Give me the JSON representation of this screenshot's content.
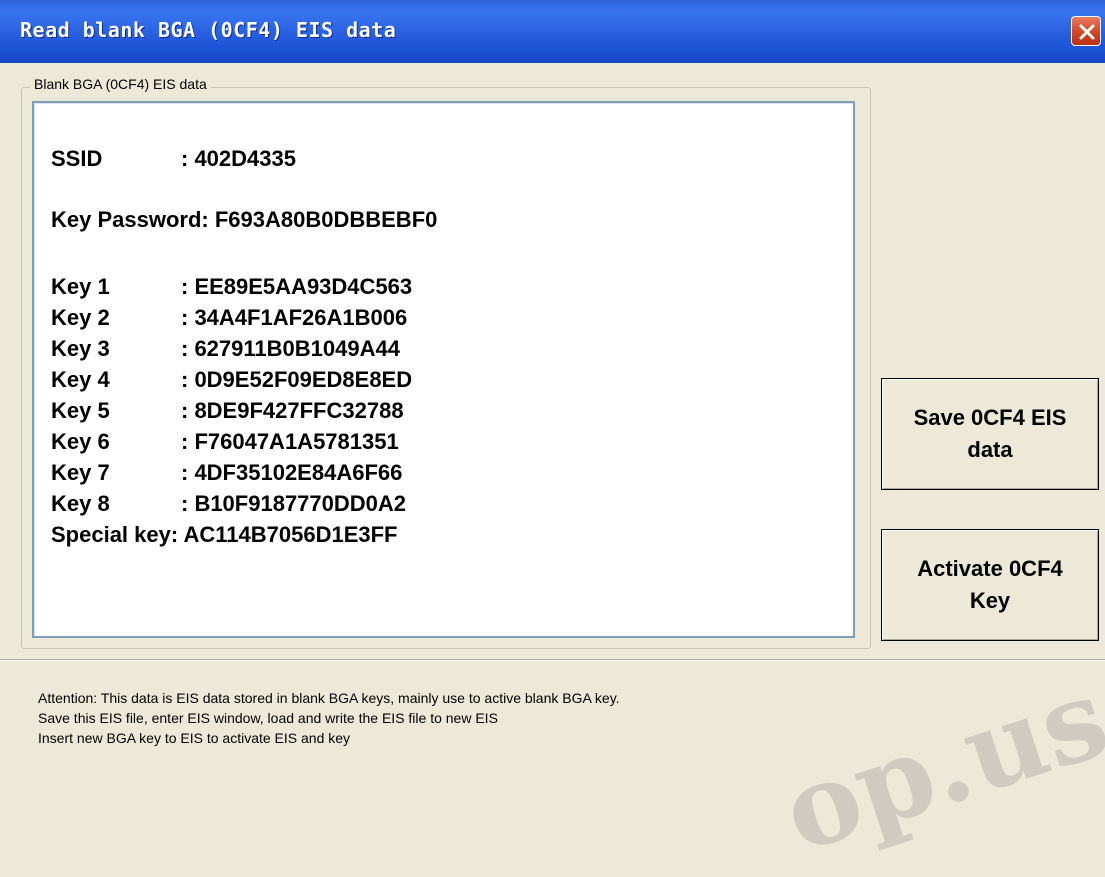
{
  "window": {
    "title": "Read blank BGA (0CF4) EIS data",
    "close_icon": "close-icon"
  },
  "groupbox": {
    "legend": "Blank BGA (0CF4) EIS data"
  },
  "eis": {
    "ssid": {
      "label": "SSID",
      "value": ": 402D4335"
    },
    "key_password": "Key Password: F693A80B0DBBEBF0",
    "keys": [
      {
        "label": "Key 1",
        "value": ": EE89E5AA93D4C563"
      },
      {
        "label": "Key 2",
        "value": ": 34A4F1AF26A1B006"
      },
      {
        "label": "Key 3",
        "value": ": 627911B0B1049A44"
      },
      {
        "label": "Key 4",
        "value": ": 0D9E52F09ED8E8ED"
      },
      {
        "label": "Key 5",
        "value": ": 8DE9F427FFC32788"
      },
      {
        "label": "Key 6",
        "value": ": F76047A1A5781351"
      },
      {
        "label": "Key 7",
        "value": ": 4DF35102E84A6F66"
      },
      {
        "label": "Key 8",
        "value": ": B10F9187770DD0A2"
      }
    ],
    "special_key": "Special key: AC114B7056D1E3FF"
  },
  "buttons": {
    "save": {
      "line1": "Save 0CF4 EIS",
      "line2": "data"
    },
    "activate": {
      "line1": "Activate 0CF4",
      "line2": "Key"
    }
  },
  "attention": {
    "line1": "Attention: This data is EIS data stored in blank BGA keys, mainly use to active blank BGA key.",
    "line2": "Save this EIS file, enter EIS window, load and write the EIS file to new EIS",
    "line3": "Insert new BGA key to EIS to activate EIS and key"
  },
  "watermark": {
    "text": "op.us"
  }
}
